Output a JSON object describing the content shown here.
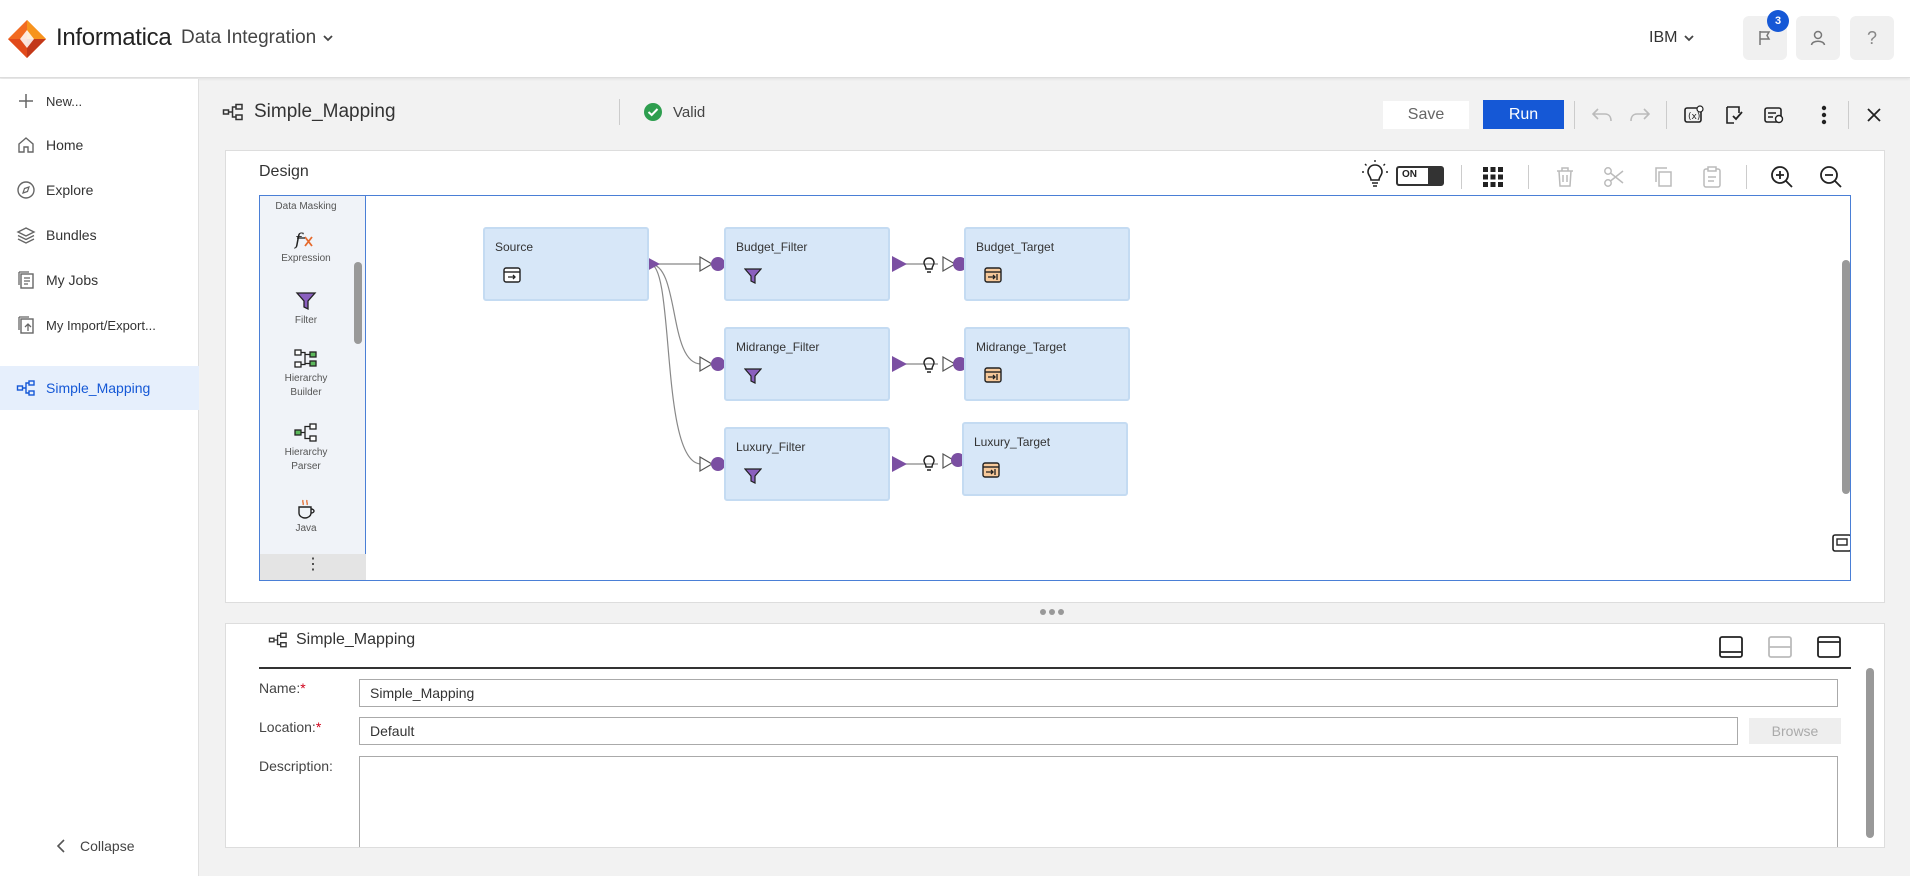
{
  "header": {
    "brand": "Informatica",
    "service": "Data Integration",
    "org": "IBM",
    "notification_count": "3"
  },
  "sidebar": {
    "items": [
      {
        "label": "New...",
        "icon": "plus-icon"
      },
      {
        "label": "Home",
        "icon": "home-icon"
      },
      {
        "label": "Explore",
        "icon": "compass-icon"
      },
      {
        "label": "Bundles",
        "icon": "layers-icon"
      },
      {
        "label": "My Jobs",
        "icon": "jobs-icon"
      },
      {
        "label": "My Import/Export...",
        "icon": "import-export-icon"
      },
      {
        "label": "Simple_Mapping",
        "icon": "mapping-icon",
        "active": true
      }
    ],
    "collapse_label": "Collapse"
  },
  "toolbar": {
    "mapping_name": "Simple_Mapping",
    "status": "Valid",
    "save_label": "Save",
    "run_label": "Run"
  },
  "design": {
    "title": "Design",
    "toggle_label": "ON",
    "palette": {
      "header": "Data Masking",
      "items": [
        {
          "label": "Expression",
          "icon": "expression-icon"
        },
        {
          "label": "Filter",
          "icon": "filter-icon"
        },
        {
          "label": "Hierarchy Builder",
          "icon": "hierarchy-builder-icon"
        },
        {
          "label": "Hierarchy Parser",
          "icon": "hierarchy-parser-icon"
        },
        {
          "label": "Java",
          "icon": "java-icon"
        }
      ]
    },
    "nodes": {
      "source": "Source",
      "budget_filter": "Budget_Filter",
      "budget_target": "Budget_Target",
      "midrange_filter": "Midrange_Filter",
      "midrange_target": "Midrange_Target",
      "luxury_filter": "Luxury_Filter",
      "luxury_target": "Luxury_Target"
    }
  },
  "properties": {
    "title": "Simple_Mapping",
    "name_label": "Name:",
    "name_value": "Simple_Mapping",
    "location_label": "Location:",
    "location_value": "Default",
    "browse_label": "Browse",
    "description_label": "Description:",
    "description_value": ""
  },
  "colors": {
    "accent": "#1558d6",
    "node_fill": "#d7e7f8",
    "port": "#7b4fa2",
    "valid": "#2e9e4f",
    "required": "#d0021b"
  }
}
